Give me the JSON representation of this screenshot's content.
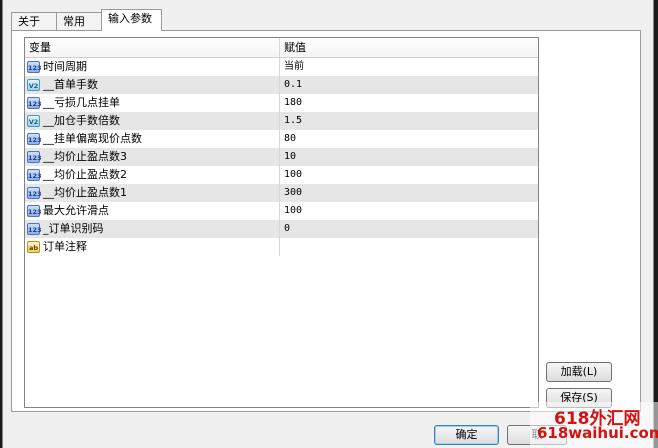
{
  "tabs": [
    {
      "label": "关于"
    },
    {
      "label": "常用"
    },
    {
      "label": "输入参数"
    }
  ],
  "grid": {
    "headers": {
      "variable": "变量",
      "value": "赋值"
    },
    "rows": [
      {
        "icon": "int-type-icon",
        "badge": "123",
        "name": "时间周期",
        "value": "当前"
      },
      {
        "icon": "double-type-icon",
        "badge": "V2",
        "name": "__首单手数",
        "value": "0.1"
      },
      {
        "icon": "int-type-icon",
        "badge": "123",
        "name": "__亏损几点挂单",
        "value": "180"
      },
      {
        "icon": "double-type-icon",
        "badge": "V2",
        "name": "__加仓手数倍数",
        "value": "1.5"
      },
      {
        "icon": "int-type-icon",
        "badge": "123",
        "name": "__挂单偏离现价点数",
        "value": "80"
      },
      {
        "icon": "int-type-icon",
        "badge": "123",
        "name": "__均价止盈点数3",
        "value": "10"
      },
      {
        "icon": "int-type-icon",
        "badge": "123",
        "name": "__均价止盈点数2",
        "value": "100"
      },
      {
        "icon": "int-type-icon",
        "badge": "123",
        "name": "__均价止盈点数1",
        "value": "300"
      },
      {
        "icon": "int-type-icon",
        "badge": "123",
        "name": "最大允许滑点",
        "value": "100"
      },
      {
        "icon": "int-type-icon",
        "badge": "123",
        "name": "_订单识别码",
        "value": "0"
      },
      {
        "icon": "string-type-icon",
        "badge": "ab",
        "name": "订单注释",
        "value": ""
      }
    ]
  },
  "buttons": {
    "load": "加载(L)",
    "save": "保存(S)",
    "ok": "确定",
    "cancel": "取"
  },
  "watermark": {
    "line1": "618外汇网",
    "line2": "618waihui.com"
  },
  "colors": {
    "watermark": "#d41212",
    "alt_row": "#e6e6e6",
    "tab_active": "#ffffff"
  }
}
